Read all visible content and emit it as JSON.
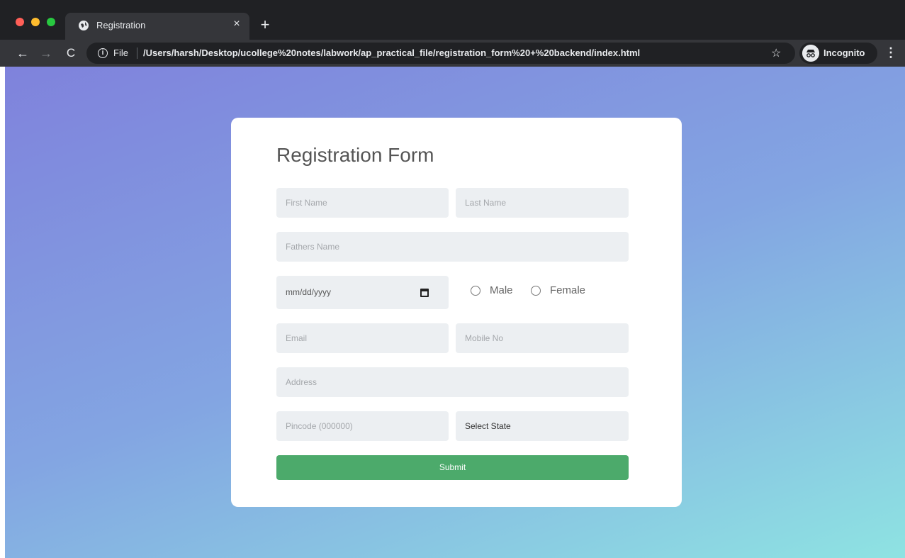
{
  "browser": {
    "tab_title": "Registration",
    "tab_close": "×",
    "new_tab": "+",
    "nav_back": "←",
    "nav_forward": "→",
    "nav_reload": "C",
    "url_scheme": "File",
    "url_path": "/Users/harsh/Desktop/ucollege%20notes/labwork/ap_practical_file/registration_form%20+%20backend/index.html",
    "bookmark_star": "☆",
    "incognito_label": "Incognito",
    "menu": "⋮"
  },
  "form": {
    "title": "Registration Form",
    "first_name_placeholder": "First Name",
    "last_name_placeholder": "Last Name",
    "fathers_name_placeholder": "Fathers Name",
    "dob_value": "mm/dd/yyyy",
    "gender_options": [
      "Male",
      "Female"
    ],
    "email_placeholder": "Email",
    "mobile_placeholder": "Mobile No",
    "address_placeholder": "Address",
    "pincode_placeholder": "Pincode (000000)",
    "state_selected": "Select State",
    "submit_label": "Submit"
  },
  "colors": {
    "submit_bg": "#4caa6b",
    "gradient_start": "#7f82dc",
    "gradient_end": "#8ee3e2"
  }
}
